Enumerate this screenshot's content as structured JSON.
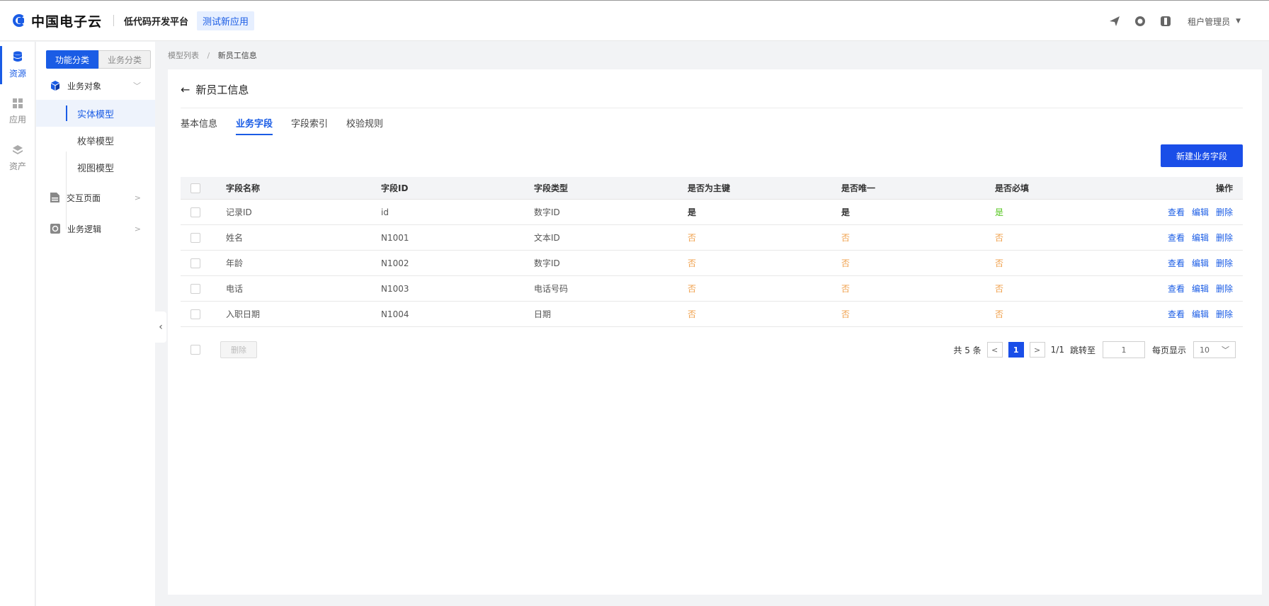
{
  "header": {
    "logo_text": "中国电子云",
    "platform": "低代码开发平台",
    "app_name": "测试新应用",
    "user": "租户管理员",
    "icons": [
      "send-icon",
      "clock-icon",
      "box-icon"
    ]
  },
  "rail": {
    "items": [
      {
        "label": "资源",
        "icon": "database-icon"
      },
      {
        "label": "应用",
        "icon": "grid-icon"
      },
      {
        "label": "资产",
        "icon": "layers-icon"
      }
    ]
  },
  "sidenav": {
    "seg_on": "功能分类",
    "seg_off": "业务分类",
    "group1": "业务对象",
    "sub1": "实体模型",
    "sub2": "枚举模型",
    "sub3": "视图模型",
    "group2": "交互页面",
    "group3": "业务逻辑"
  },
  "breadcrumb": {
    "parent": "模型列表",
    "sep": "/",
    "current": "新员工信息"
  },
  "page": {
    "back": "←",
    "title": "新员工信息",
    "new_button": "新建业务字段"
  },
  "tabs": [
    "基本信息",
    "业务字段",
    "字段索引",
    "校验规则"
  ],
  "table": {
    "headers": {
      "name": "字段名称",
      "id": "字段ID",
      "type": "字段类型",
      "pk": "是否为主键",
      "unique": "是否唯一",
      "required": "是否必填",
      "ops": "操作"
    },
    "rows": [
      {
        "name": "记录ID",
        "id": "id",
        "type": "数字ID",
        "pk": "是",
        "unique": "是",
        "required": "是"
      },
      {
        "name": "姓名",
        "id": "N1001",
        "type": "文本ID",
        "pk": "否",
        "unique": "否",
        "required": "否"
      },
      {
        "name": "年龄",
        "id": "N1002",
        "type": "数字ID",
        "pk": "否",
        "unique": "否",
        "required": "否"
      },
      {
        "name": "电话",
        "id": "N1003",
        "type": "电话号码",
        "pk": "否",
        "unique": "否",
        "required": "否"
      },
      {
        "name": "入职日期",
        "id": "N1004",
        "type": "日期",
        "pk": "否",
        "unique": "否",
        "required": "否"
      }
    ],
    "ops": {
      "view": "查看",
      "edit": "编辑",
      "delete": "删除"
    }
  },
  "footer": {
    "delete": "删除",
    "total": "共 5 条",
    "prev": "<",
    "page": "1",
    "next": ">",
    "pages": "1/1",
    "jump_label": "跳转至",
    "jump_value": "1",
    "per_page_label": "每页显示",
    "per_page_value": "10"
  },
  "colors": {
    "accent": "#1a5ce5",
    "no": "#f0a04b",
    "yes_green": "#52c41a"
  }
}
